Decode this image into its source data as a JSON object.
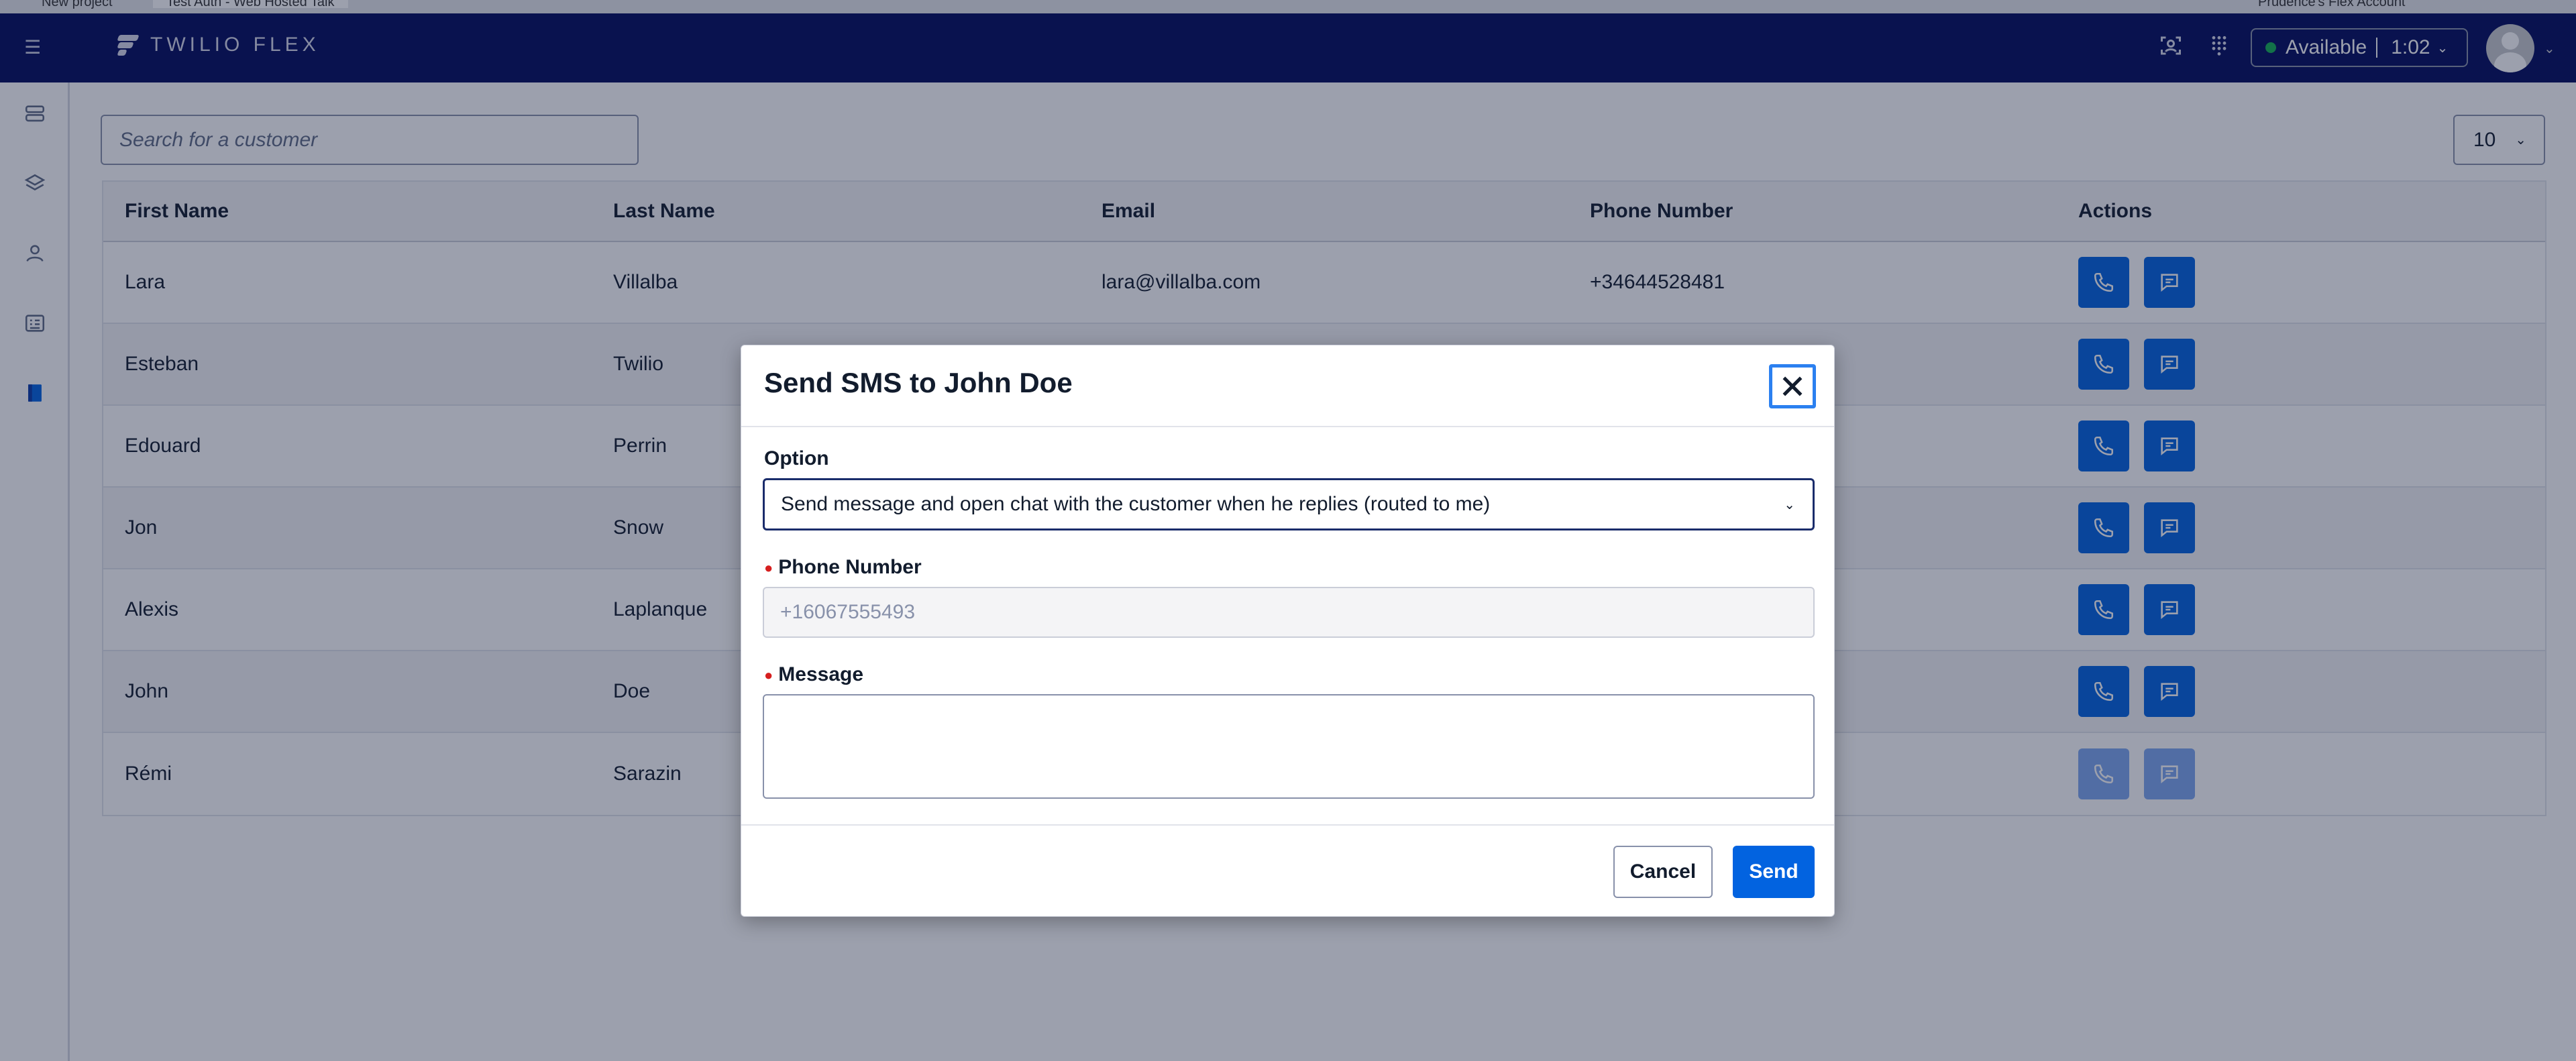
{
  "browser": {
    "tab_left": "New project",
    "tab_active": "Test Auth - Web Hosted Talk",
    "tab_right": "Prudence's Flex Account"
  },
  "topbar": {
    "logo_text": "TWILIO FLEX",
    "status_label": "Available",
    "status_timer": "1:02",
    "status_color": "#14b053"
  },
  "toolbar": {
    "search_placeholder": "Search for a customer",
    "page_size": "10"
  },
  "table": {
    "columns": [
      "First Name",
      "Last Name",
      "Email",
      "Phone Number",
      "Actions"
    ],
    "rows": [
      {
        "first": "Lara",
        "last": "Villalba",
        "email": "lara@villalba.com",
        "phone": "+34644528481",
        "enabled": true
      },
      {
        "first": "Esteban",
        "last": "Twilio",
        "email": "",
        "phone": "",
        "enabled": true
      },
      {
        "first": "Edouard",
        "last": "Perrin",
        "email": "",
        "phone": "",
        "enabled": true
      },
      {
        "first": "Jon",
        "last": "Snow",
        "email": "",
        "phone": "",
        "enabled": true
      },
      {
        "first": "Alexis",
        "last": "Laplanque",
        "email": "",
        "phone": "",
        "enabled": true
      },
      {
        "first": "John",
        "last": "Doe",
        "email": "",
        "phone": "",
        "enabled": true
      },
      {
        "first": "Rémi",
        "last": "Sarazin",
        "email": "",
        "phone": "",
        "enabled": false
      }
    ]
  },
  "modal": {
    "title": "Send SMS to John Doe",
    "option_label": "Option",
    "option_value": "Send message and open chat with the customer when he replies (routed to me)",
    "phone_label": "Phone Number",
    "phone_value": "+16067555493",
    "message_label": "Message",
    "message_value": "",
    "cancel_label": "Cancel",
    "send_label": "Send"
  },
  "colors": {
    "nav_bg": "#030b5d",
    "primary": "#0263e0",
    "required": "#d61f1f"
  }
}
